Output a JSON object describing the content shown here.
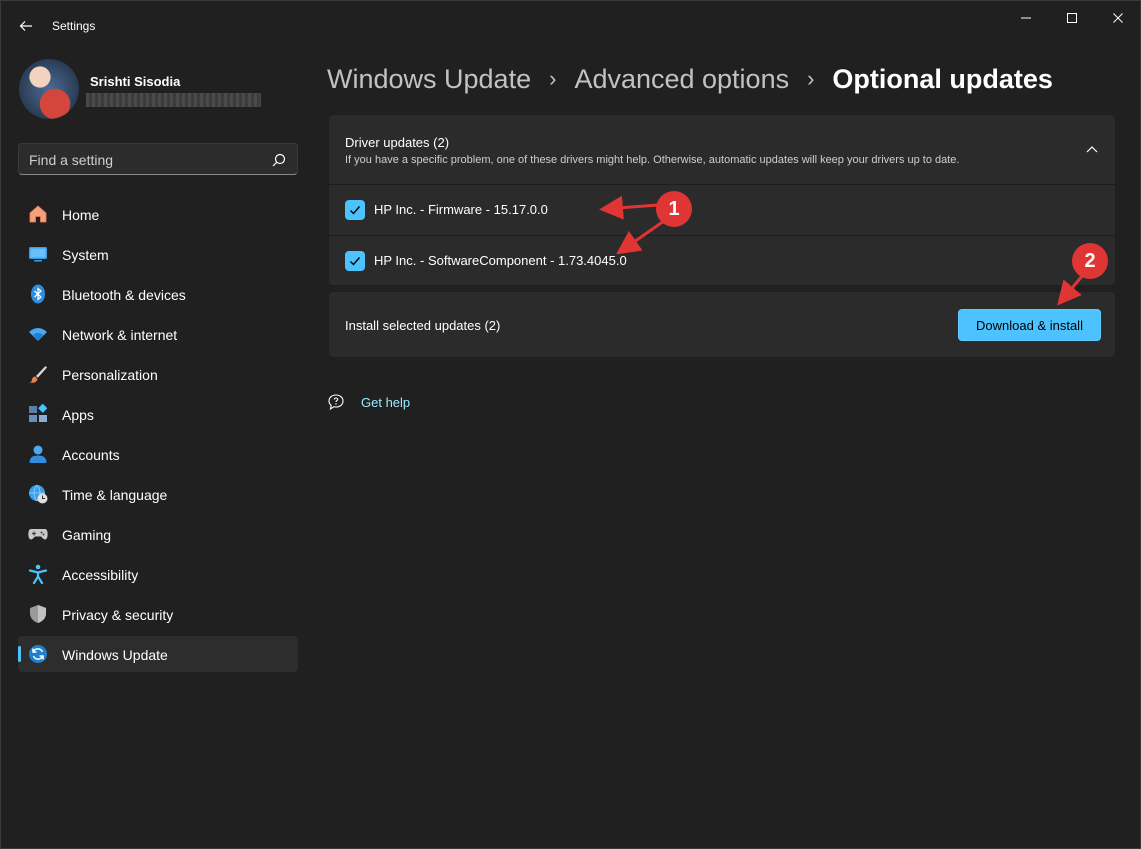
{
  "window": {
    "title": "Settings"
  },
  "profile": {
    "name": "Srishti Sisodia"
  },
  "search": {
    "placeholder": "Find a setting"
  },
  "sidebar": {
    "items": [
      {
        "label": "Home",
        "icon": "home-icon"
      },
      {
        "label": "System",
        "icon": "system-icon"
      },
      {
        "label": "Bluetooth & devices",
        "icon": "bluetooth-icon"
      },
      {
        "label": "Network & internet",
        "icon": "wifi-icon"
      },
      {
        "label": "Personalization",
        "icon": "brush-icon"
      },
      {
        "label": "Apps",
        "icon": "apps-icon"
      },
      {
        "label": "Accounts",
        "icon": "accounts-icon"
      },
      {
        "label": "Time & language",
        "icon": "globe-clock-icon"
      },
      {
        "label": "Gaming",
        "icon": "gamepad-icon"
      },
      {
        "label": "Accessibility",
        "icon": "accessibility-icon"
      },
      {
        "label": "Privacy & security",
        "icon": "shield-icon"
      },
      {
        "label": "Windows Update",
        "icon": "update-icon",
        "selected": true
      }
    ]
  },
  "breadcrumb": {
    "items": [
      "Windows Update",
      "Advanced options",
      "Optional updates"
    ],
    "separator": "›"
  },
  "driver_updates": {
    "title": "Driver updates (2)",
    "description": "If you have a specific problem, one of these drivers might help. Otherwise, automatic updates will keep your drivers up to date.",
    "items": [
      {
        "label": "HP Inc. - Firmware - 15.17.0.0",
        "checked": true
      },
      {
        "label": "HP Inc. - SoftwareComponent - 1.73.4045.0",
        "checked": true
      }
    ]
  },
  "install": {
    "label": "Install selected updates (2)",
    "button_label": "Download & install"
  },
  "help": {
    "label": "Get help"
  },
  "annotations": {
    "badge_1": "1",
    "badge_2": "2"
  },
  "colors": {
    "accent": "#4cc2ff",
    "background": "#202020",
    "card": "#2b2b2b",
    "annotation": "#e03535",
    "link": "#99ebff"
  }
}
